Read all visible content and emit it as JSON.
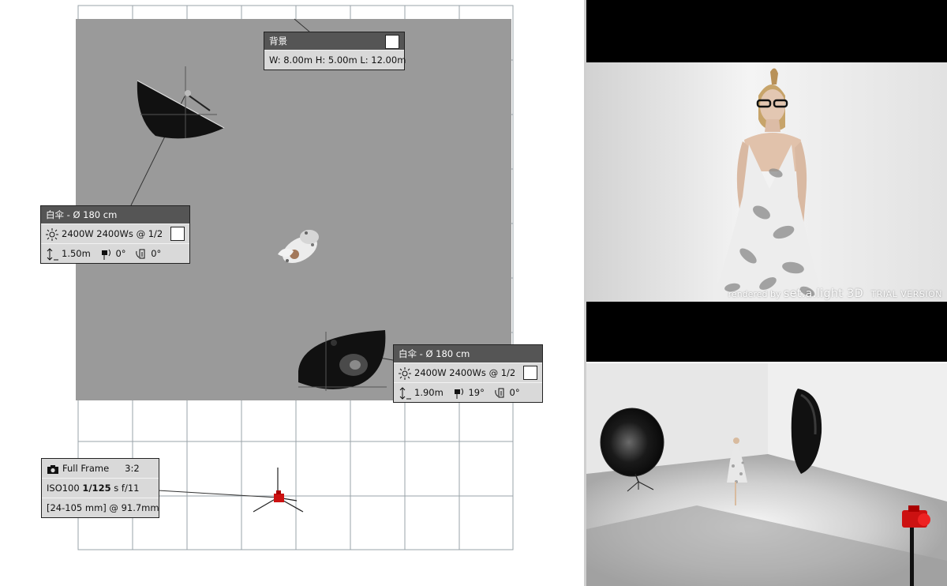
{
  "background_panel": {
    "title": "背景",
    "dimensions": "W: 8.00m H: 5.00m L: 12.00m"
  },
  "light1": {
    "title": "白伞 - Ø 180 cm",
    "power": "2400W 2400Ws @ 1/2",
    "height": "1.50m",
    "tilt": "0°",
    "rotation": "0°"
  },
  "light2": {
    "title": "白伞 - Ø 180 cm",
    "power": "2400W 2400Ws @ 1/2",
    "height": "1.90m",
    "tilt": "19°",
    "rotation": "0°"
  },
  "camera": {
    "sensor": "Full Frame",
    "aspect": "3:2",
    "iso": "ISO100",
    "shutter": "1/125",
    "shutter_unit": "s",
    "aperture": "f/11",
    "lens": "[24-105 mm] @ 91.7mm"
  },
  "render": {
    "watermark_prefix": "rendered by",
    "watermark_brand": "set.a.light 3D",
    "watermark_trial": "TRIAL VERSION"
  },
  "icons": [
    "camera-icon",
    "sun-icon",
    "height-icon",
    "tilt-icon",
    "rotation-icon"
  ],
  "colors": {
    "backdrop": "#9a9a9a",
    "panel_header": "#555555",
    "panel_body": "#d9d9d9",
    "camera_red": "#cc1111"
  }
}
